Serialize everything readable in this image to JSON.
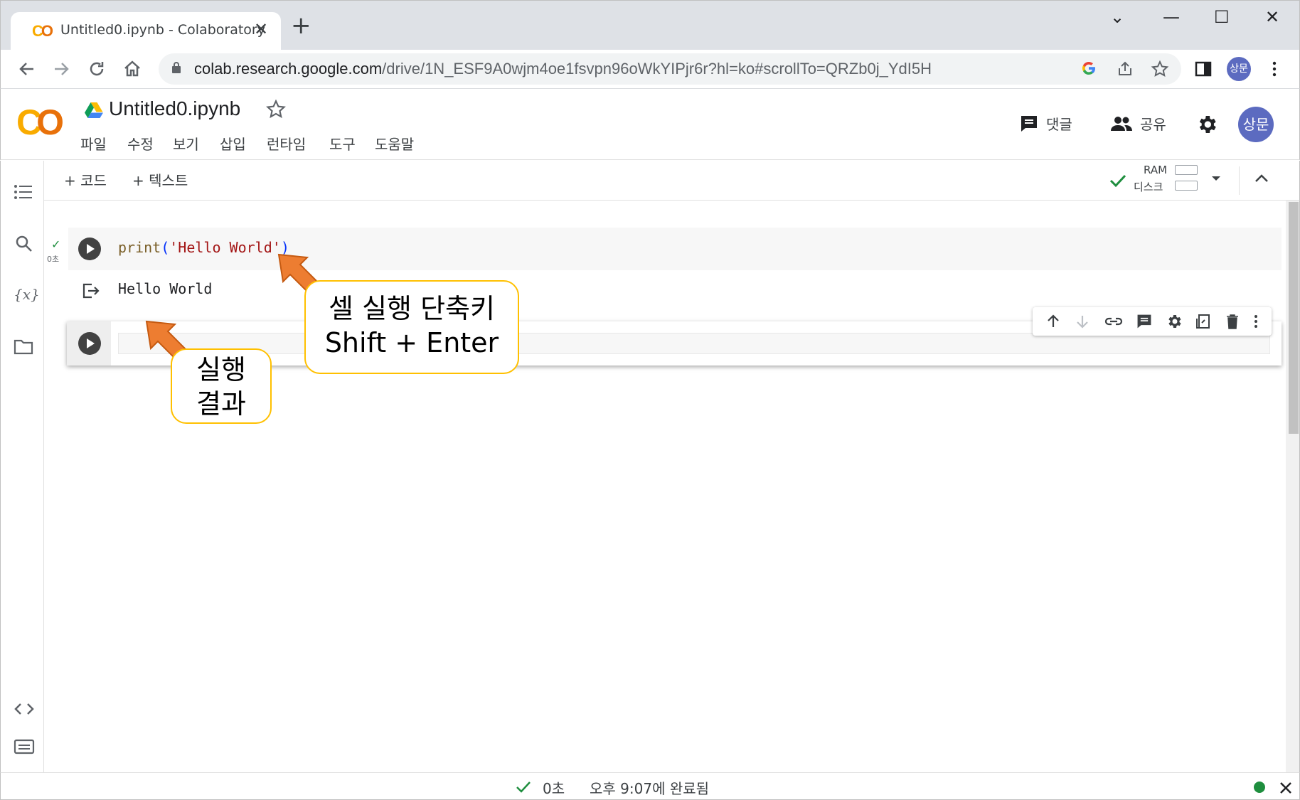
{
  "browser": {
    "tab_title": "Untitled0.ipynb - Colaboratory",
    "tab_logo": [
      "C",
      "O"
    ],
    "close_glyph": "✕",
    "new_tab_glyph": "+",
    "window_controls": [
      "⌄",
      "—",
      "☐",
      "✕"
    ],
    "url_host": "colab.research.google.com",
    "url_path": "/drive/1N_ESF9A0wjm4oe1fsvpn96oWkYIPjr6r?hl=ko#scrollTo=QRZb0j_YdI5H",
    "profile_initials": "상문"
  },
  "header": {
    "title": "Untitled0.ipynb",
    "menu": [
      "파일",
      "수정",
      "보기",
      "삽입",
      "런타임",
      "도구",
      "도움말"
    ],
    "comment_label": "댓글",
    "share_label": "공유",
    "avatar_initials": "상문"
  },
  "toolbar": {
    "add_code": "+ 코드",
    "add_text": "+ 텍스트",
    "ram_label": "RAM",
    "disk_label": "디스크"
  },
  "cells": {
    "code_fn": "print",
    "code_open": "(",
    "code_string": "'Hello World'",
    "code_close": ")",
    "exec_time": "0초",
    "output": "Hello World"
  },
  "status": {
    "check": "✓",
    "duration": "0초",
    "completed": "오후 9:07에 완료됨"
  },
  "annotations": {
    "shortcut_line1": "셀 실행 단축키",
    "shortcut_line2": "Shift + Enter",
    "result_line1": "실행",
    "result_line2": "결과"
  },
  "colors": {
    "annotation_border": "#ffc000",
    "arrow_fill": "#ed7d31",
    "arrow_stroke": "#c55a11",
    "colab_orange": "#e8710a",
    "colab_yellow": "#f9ab00"
  }
}
